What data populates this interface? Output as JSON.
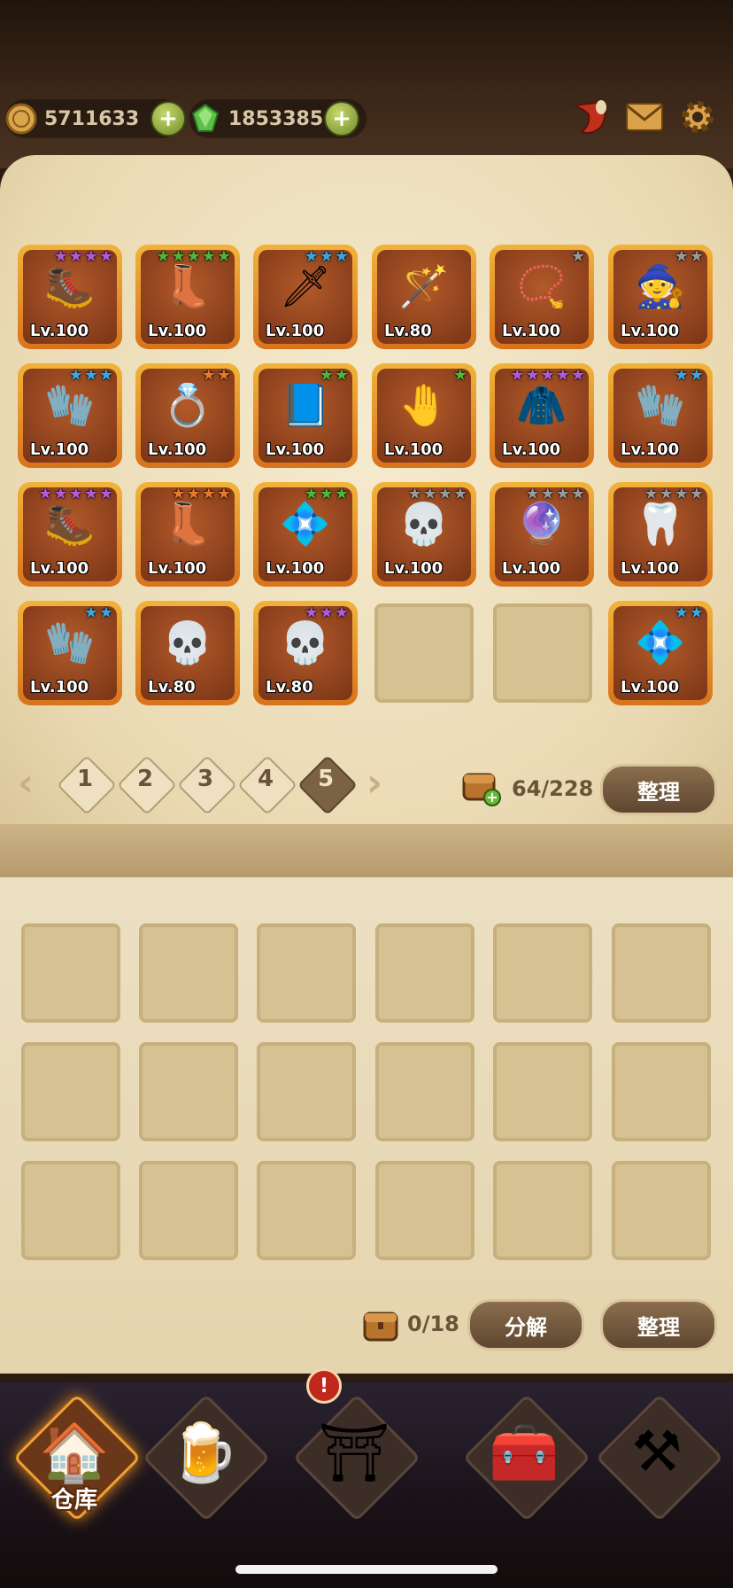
{
  "currency": {
    "gold": "5711633",
    "gems": "1853385",
    "gold_icon": "coin-icon",
    "gem_icon": "gem-icon",
    "add_label": "+"
  },
  "top_icons": [
    "horn-icon",
    "mail-icon",
    "gear-icon"
  ],
  "inventory": {
    "items": [
      {
        "icon": "boots-icon",
        "glyph": "🥾",
        "level": "Lv.100",
        "stars": 4,
        "star_color": "#b25ad8"
      },
      {
        "icon": "boots-icon",
        "glyph": "👢",
        "level": "Lv.100",
        "stars": 5,
        "star_color": "#4cb83c"
      },
      {
        "icon": "claw-icon",
        "glyph": "🗡",
        "level": "Lv.100",
        "stars": 3,
        "star_color": "#3aa8e0"
      },
      {
        "icon": "staff-icon",
        "glyph": "🪄",
        "level": "Lv.80",
        "stars": 0,
        "star_color": "#888888"
      },
      {
        "icon": "amulet-icon",
        "glyph": "📿",
        "level": "Lv.100",
        "stars": 1,
        "star_color": "#9a9a9a"
      },
      {
        "icon": "hood-icon",
        "glyph": "🧙",
        "level": "Lv.100",
        "stars": 2,
        "star_color": "#9a9a9a"
      },
      {
        "icon": "gloves-icon",
        "glyph": "🧤",
        "level": "Lv.100",
        "stars": 3,
        "star_color": "#3aa8e0"
      },
      {
        "icon": "ring-icon",
        "glyph": "💍",
        "level": "Lv.100",
        "stars": 2,
        "star_color": "#e8782a"
      },
      {
        "icon": "tome-icon",
        "glyph": "📘",
        "level": "Lv.100",
        "stars": 2,
        "star_color": "#4cb83c"
      },
      {
        "icon": "gloves-icon",
        "glyph": "🤚",
        "level": "Lv.100",
        "stars": 1,
        "star_color": "#4cb83c"
      },
      {
        "icon": "cloak-icon",
        "glyph": "🧥",
        "level": "Lv.100",
        "stars": 5,
        "star_color": "#b25ad8"
      },
      {
        "icon": "gloves-icon",
        "glyph": "🧤",
        "level": "Lv.100",
        "stars": 2,
        "star_color": "#3aa8e0"
      },
      {
        "icon": "boots-icon",
        "glyph": "🥾",
        "level": "Lv.100",
        "stars": 5,
        "star_color": "#b25ad8"
      },
      {
        "icon": "boots-icon",
        "glyph": "👢",
        "level": "Lv.100",
        "stars": 4,
        "star_color": "#e8782a"
      },
      {
        "icon": "amulet-icon",
        "glyph": "💠",
        "level": "Lv.100",
        "stars": 3,
        "star_color": "#4cb83c"
      },
      {
        "icon": "boots-icon",
        "glyph": "💀",
        "level": "Lv.100",
        "stars": 4,
        "star_color": "#9a9a9a"
      },
      {
        "icon": "ring-icon",
        "glyph": "🔮",
        "level": "Lv.100",
        "stars": 4,
        "star_color": "#9a9a9a"
      },
      {
        "icon": "amulet-icon",
        "glyph": "🦷",
        "level": "Lv.100",
        "stars": 4,
        "star_color": "#9a9a9a"
      },
      {
        "icon": "gloves-icon",
        "glyph": "🧤",
        "level": "Lv.100",
        "stars": 2,
        "star_color": "#3aa8e0"
      },
      {
        "icon": "boots-icon",
        "glyph": "💀",
        "level": "Lv.80",
        "stars": 0,
        "star_color": "#888888"
      },
      {
        "icon": "boots-icon",
        "glyph": "💀",
        "level": "Lv.80",
        "stars": 3,
        "star_color": "#b25ad8"
      },
      {
        "icon": "amulet-icon",
        "glyph": "💠",
        "level": "Lv.100",
        "stars": 2,
        "star_color": "#3aa8e0"
      }
    ],
    "pages": [
      "1",
      "2",
      "3",
      "4",
      "5"
    ],
    "active_page": "5",
    "capacity": "64/228",
    "sort_label": "整理"
  },
  "salvage": {
    "capacity": "0/18",
    "decompose_label": "分解",
    "sort_label": "整理"
  },
  "nav": {
    "warehouse_label": "仓库",
    "items": [
      "warehouse-icon",
      "tavern-mug-icon",
      "portal-icon",
      "treasure-chest-icon",
      "forge-icon"
    ],
    "alert": "!"
  }
}
